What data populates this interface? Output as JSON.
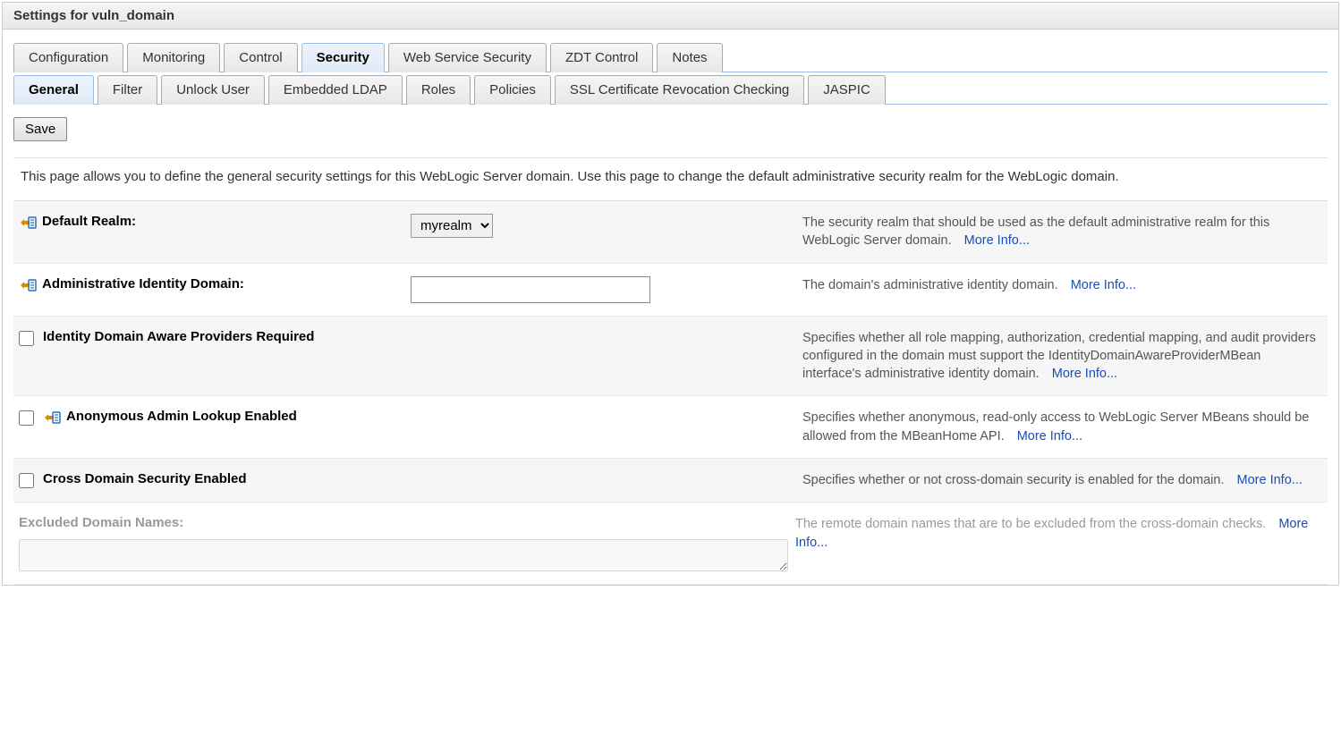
{
  "title": "Settings for vuln_domain",
  "tabs_main": [
    "Configuration",
    "Monitoring",
    "Control",
    "Security",
    "Web Service Security",
    "ZDT Control",
    "Notes"
  ],
  "tabs_main_active": 3,
  "tabs_sub": [
    "General",
    "Filter",
    "Unlock User",
    "Embedded LDAP",
    "Roles",
    "Policies",
    "SSL Certificate Revocation Checking",
    "JASPIC"
  ],
  "tabs_sub_active": 0,
  "save_label": "Save",
  "description": "This page allows you to define the general security settings for this WebLogic Server domain. Use this page to change the default administrative security realm for the WebLogic domain.",
  "more_info_label": "More Info...",
  "fields": {
    "default_realm": {
      "label": "Default Realm:",
      "value": "myrealm",
      "help": "The security realm that should be used as the default administrative realm for this WebLogic Server domain."
    },
    "admin_identity_domain": {
      "label": "Administrative Identity Domain:",
      "value": "",
      "help": "The domain's administrative identity domain."
    },
    "identity_aware_required": {
      "label": "Identity Domain Aware Providers Required",
      "checked": false,
      "help": "Specifies whether all role mapping, authorization, credential mapping, and audit providers configured in the domain must support the IdentityDomainAwareProviderMBean interface's administrative identity domain."
    },
    "anonymous_admin_lookup": {
      "label": "Anonymous Admin Lookup Enabled",
      "checked": false,
      "help": "Specifies whether anonymous, read-only access to WebLogic Server MBeans should be allowed from the MBeanHome API."
    },
    "cross_domain_security": {
      "label": "Cross Domain Security Enabled",
      "checked": false,
      "help": "Specifies whether or not cross-domain security is enabled for the domain."
    },
    "excluded_domain_names": {
      "label": "Excluded Domain Names:",
      "value": "",
      "help": "The remote domain names that are to be excluded from the cross-domain checks."
    }
  }
}
